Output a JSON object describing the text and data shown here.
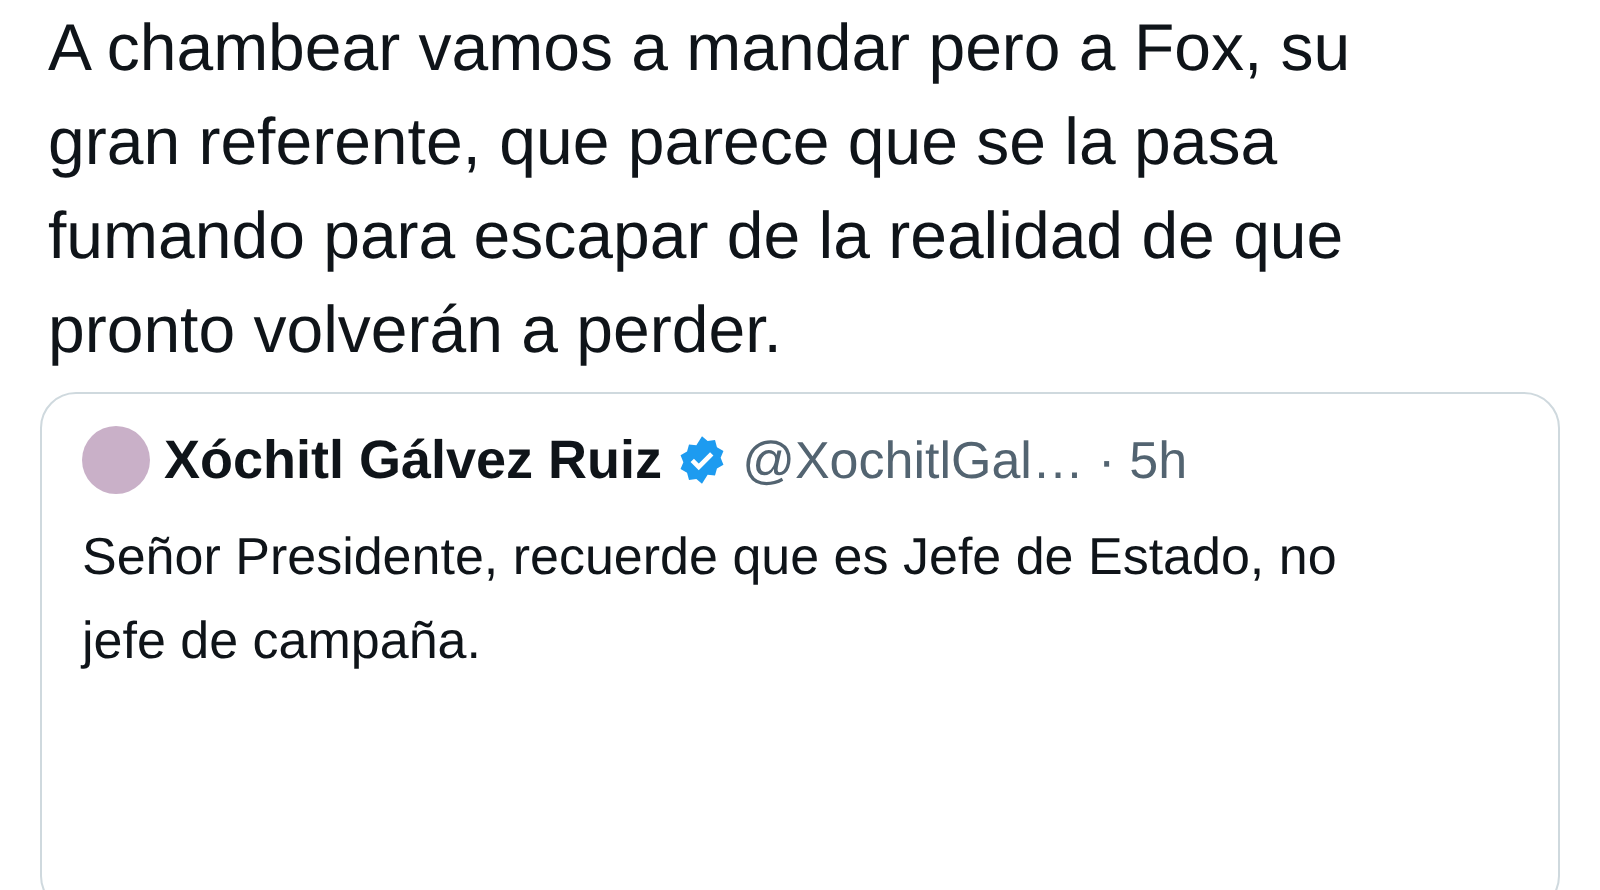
{
  "tweet": {
    "text": "A chambear vamos a mandar pero a Fox, su gran referente, que parece que se la pasa fumando para escapar de la realidad de que pronto volverán a perder."
  },
  "quoted_tweet": {
    "name": "Xóchitl Gálvez Ruiz",
    "verified": true,
    "handle": "@XochitlGal…",
    "separator": "·",
    "time": "5h",
    "text": "Señor Presidente, recuerde que es Jefe de Estado, no jefe de campaña."
  }
}
